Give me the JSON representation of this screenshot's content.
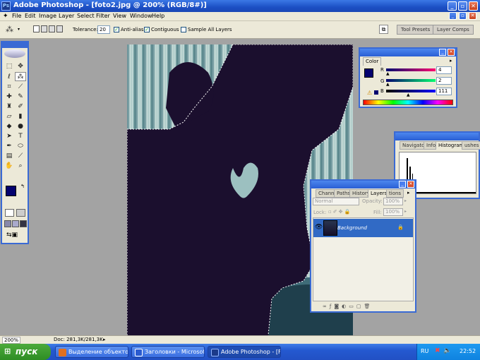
{
  "window": {
    "title": "Adobe Photoshop - [foto2.jpg @ 200% (RGB/8#)]"
  },
  "menu": [
    "File",
    "Edit",
    "Image",
    "Layer",
    "Select",
    "Filter",
    "View",
    "Window",
    "Help"
  ],
  "options": {
    "tolerance_label": "Tolerance:",
    "tolerance_value": "20",
    "antialias_label": "Anti-alias",
    "contiguous_label": "Contiguous",
    "sample_all_label": "Sample All Layers",
    "wells": [
      "Tool Presets",
      "Layer Comps"
    ]
  },
  "color_panel": {
    "tab": "Color",
    "channels": [
      {
        "label": "R",
        "value": "4"
      },
      {
        "label": "G",
        "value": "2"
      },
      {
        "label": "B",
        "value": "111"
      }
    ],
    "foreground_hex": "#04026f"
  },
  "nav_panel": {
    "tabs": [
      "Navigator",
      "Info",
      "Histogram"
    ],
    "partial_tab": "ushes"
  },
  "layers_panel": {
    "tabs": [
      "Channe",
      "Paths",
      "History",
      "Layers",
      "tions"
    ],
    "blend_mode": "Normal",
    "opacity_label": "Opacity:",
    "opacity_value": "100%",
    "lock_label": "Lock:",
    "fill_label": "Fill:",
    "fill_value": "100%",
    "layer_name": "Background"
  },
  "status": {
    "zoom": "200%",
    "doc": "Doc: 281,3K/281,3K"
  },
  "taskbar": {
    "start_label": "пуск",
    "buttons": [
      {
        "label": "Выделение объекто...",
        "color": "#e07020"
      },
      {
        "label": "Заголовки - Microsof...",
        "color": "#2a5bd0"
      },
      {
        "label": "Adobe Photoshop - [F...",
        "color": "#1b3a8a"
      }
    ],
    "lang": "RU",
    "clock": "22:52"
  },
  "colors": {
    "accent": "#3a6ad4",
    "panel": "#ece9d8",
    "selected_layer": "#316ac5"
  }
}
